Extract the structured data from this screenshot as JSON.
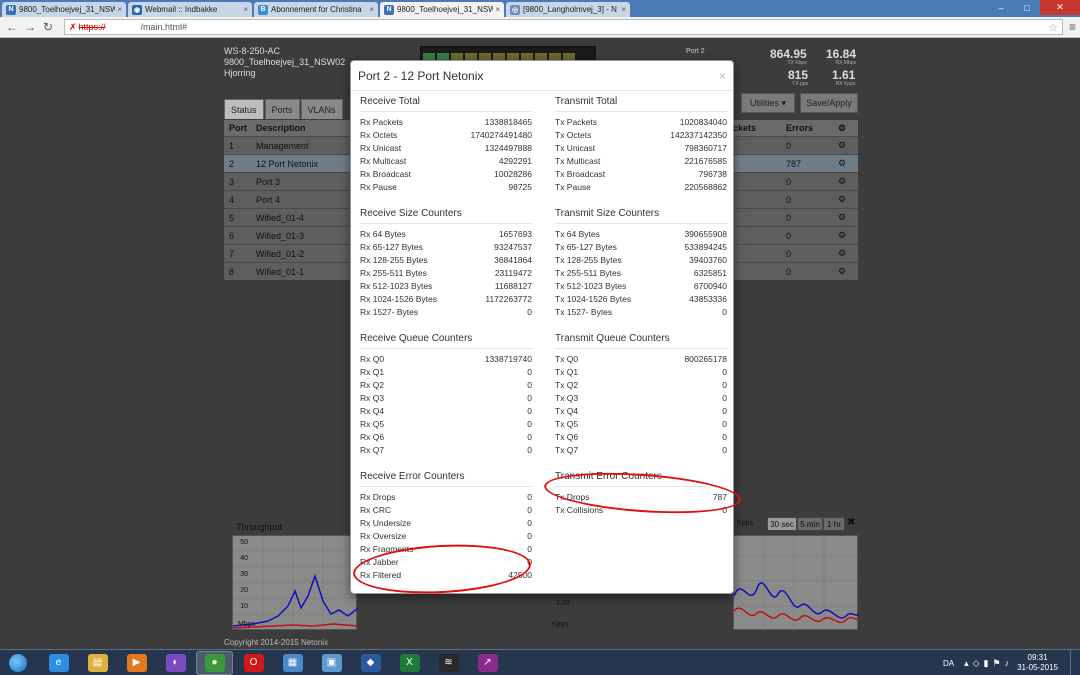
{
  "browser": {
    "tabs": [
      {
        "label": "9800_Toelhoejvej_31_NSW",
        "icon": "N",
        "icon_color": "#3b6fb6",
        "active": false
      },
      {
        "label": "Webmail :: Indbakke",
        "icon": "◉",
        "icon_color": "#2a6aa8",
        "active": false
      },
      {
        "label": "Abonnement for Christina",
        "icon": "B",
        "icon_color": "#3b8fd6",
        "active": false
      },
      {
        "label": "9800_Toelhoejvej_31_NSW",
        "icon": "N",
        "icon_color": "#3b6fb6",
        "active": true
      },
      {
        "label": "[9800_Langholmvej_3] - N",
        "icon": "◎",
        "icon_color": "#6a8fbf",
        "active": false
      }
    ],
    "url_scheme": "https://",
    "url_path": "/main.html#"
  },
  "device": {
    "model": "WS-8-250-AC",
    "name": "9800_Toelhoejvej_31_NSW02",
    "location": "Hjorring",
    "port_label": "Port 2",
    "stats": [
      {
        "value": "864.95",
        "unit": "TX Kbps"
      },
      {
        "value": "16.84",
        "unit": "RX Mbps"
      },
      {
        "value": "815",
        "unit": "TX pps"
      },
      {
        "value": "1.61",
        "unit": "RX Kpps"
      }
    ]
  },
  "page_tabs": [
    "Status",
    "Ports",
    "VLANs"
  ],
  "buttons": {
    "utilities": "Utilities ▾",
    "save": "Save/Apply"
  },
  "ports_table": {
    "headers": {
      "port": "Port",
      "description": "Description",
      "packets": "ackets",
      "errors": "Errors"
    },
    "rows": [
      {
        "port": "1",
        "desc": "Management",
        "errors": "0"
      },
      {
        "port": "2",
        "desc": "12 Port Netonix",
        "errors": "787"
      },
      {
        "port": "3",
        "desc": "Port 3",
        "errors": "0"
      },
      {
        "port": "4",
        "desc": "Port 4",
        "errors": "0"
      },
      {
        "port": "5",
        "desc": "Wified_01-4",
        "errors": "0"
      },
      {
        "port": "6",
        "desc": "Wified_01-3",
        "errors": "0"
      },
      {
        "port": "7",
        "desc": "Wified_01-2",
        "errors": "0"
      },
      {
        "port": "8",
        "desc": "Wified_01-1",
        "errors": "0"
      }
    ]
  },
  "throughput": {
    "title": "Throughput",
    "yticks": [
      "50",
      "40",
      "30",
      "20",
      "10"
    ],
    "unit_left": "Mbps",
    "unit_right": "Kpps",
    "right_tick": "1.00",
    "ranges": [
      "30 sec",
      "5 min",
      "1 hr"
    ],
    "close": "✖"
  },
  "copyright": "Copyright 2014-2015 Netonix",
  "modal": {
    "title": "Port 2 - 12 Port Netonix",
    "close": "×",
    "left": [
      {
        "title": "Receive Total",
        "rows": [
          {
            "k": "Rx Packets",
            "v": "1338818465"
          },
          {
            "k": "Rx Octets",
            "v": "1740274491480"
          },
          {
            "k": "Rx Unicast",
            "v": "1324497888"
          },
          {
            "k": "Rx Multicast",
            "v": "4292291"
          },
          {
            "k": "Rx Broadcast",
            "v": "10028286"
          },
          {
            "k": "Rx Pause",
            "v": "98725"
          }
        ]
      },
      {
        "title": "Receive Size Counters",
        "rows": [
          {
            "k": "Rx 64 Bytes",
            "v": "1657693"
          },
          {
            "k": "Rx 65-127 Bytes",
            "v": "93247537"
          },
          {
            "k": "Rx 128-255 Bytes",
            "v": "36841864"
          },
          {
            "k": "Rx 255-511 Bytes",
            "v": "23119472"
          },
          {
            "k": "Rx 512-1023 Bytes",
            "v": "11688127"
          },
          {
            "k": "Rx 1024-1526 Bytes",
            "v": "1172263772"
          },
          {
            "k": "Rx 1527- Bytes",
            "v": "0"
          }
        ]
      },
      {
        "title": "Receive Queue Counters",
        "rows": [
          {
            "k": "Rx Q0",
            "v": "1338719740"
          },
          {
            "k": "Rx Q1",
            "v": "0"
          },
          {
            "k": "Rx Q2",
            "v": "0"
          },
          {
            "k": "Rx Q3",
            "v": "0"
          },
          {
            "k": "Rx Q4",
            "v": "0"
          },
          {
            "k": "Rx Q5",
            "v": "0"
          },
          {
            "k": "Rx Q6",
            "v": "0"
          },
          {
            "k": "Rx Q7",
            "v": "0"
          }
        ]
      },
      {
        "title": "Receive Error Counters",
        "rows": [
          {
            "k": "Rx Drops",
            "v": "0"
          },
          {
            "k": "Rx CRC",
            "v": "0"
          },
          {
            "k": "Rx Undersize",
            "v": "0"
          },
          {
            "k": "Rx Oversize",
            "v": "0"
          },
          {
            "k": "Rx Fragments",
            "v": "0"
          },
          {
            "k": "Rx Jabber",
            "v": "0"
          },
          {
            "k": "Rx Filtered",
            "v": "42500"
          }
        ]
      }
    ],
    "right": [
      {
        "title": "Transmit Total",
        "rows": [
          {
            "k": "Tx Packets",
            "v": "1020834040"
          },
          {
            "k": "Tx Octets",
            "v": "142337142350"
          },
          {
            "k": "Tx Unicast",
            "v": "798360717"
          },
          {
            "k": "Tx Multicast",
            "v": "221676585"
          },
          {
            "k": "Tx Broadcast",
            "v": "796738"
          },
          {
            "k": "Tx Pause",
            "v": "220568862"
          }
        ]
      },
      {
        "title": "Transmit Size Counters",
        "rows": [
          {
            "k": "Tx 64 Bytes",
            "v": "390655908"
          },
          {
            "k": "Tx 65-127 Bytes",
            "v": "533894245"
          },
          {
            "k": "Tx 128-255 Bytes",
            "v": "39403760"
          },
          {
            "k": "Tx 255-511 Bytes",
            "v": "6325851"
          },
          {
            "k": "Tx 512-1023 Bytes",
            "v": "6700940"
          },
          {
            "k": "Tx 1024-1526 Bytes",
            "v": "43853336"
          },
          {
            "k": "Tx 1527- Bytes",
            "v": "0"
          }
        ]
      },
      {
        "title": "Transmit Queue Counters",
        "rows": [
          {
            "k": "Tx Q0",
            "v": "800265178"
          },
          {
            "k": "Tx Q1",
            "v": "0"
          },
          {
            "k": "Tx Q2",
            "v": "0"
          },
          {
            "k": "Tx Q3",
            "v": "0"
          },
          {
            "k": "Tx Q4",
            "v": "0"
          },
          {
            "k": "Tx Q5",
            "v": "0"
          },
          {
            "k": "Tx Q6",
            "v": "0"
          },
          {
            "k": "Tx Q7",
            "v": "0"
          }
        ]
      },
      {
        "title": "Transmit Error Counters",
        "rows": [
          {
            "k": "Tx Drops",
            "v": "787"
          },
          {
            "k": "Tx Collisions",
            "v": "0"
          }
        ]
      }
    ]
  },
  "taskbar": {
    "apps": [
      {
        "name": "ie-icon",
        "glyph": "e",
        "color": "#2d8ee0"
      },
      {
        "name": "explorer-icon",
        "glyph": "▤",
        "color": "#e0b040"
      },
      {
        "name": "media-player-icon",
        "glyph": "▶",
        "color": "#e07a20"
      },
      {
        "name": "bittorrent-icon",
        "glyph": "◐",
        "color": "#7a4ac0"
      },
      {
        "name": "chrome-icon",
        "glyph": "●",
        "color": "#3a9a3a"
      },
      {
        "name": "opera-icon",
        "glyph": "O",
        "color": "#d01818"
      },
      {
        "name": "control-panel-icon",
        "glyph": "▦",
        "color": "#4a8ac8"
      },
      {
        "name": "remote-desktop-icon",
        "glyph": "▣",
        "color": "#5a9ad0"
      },
      {
        "name": "virtualbox-icon",
        "glyph": "◆",
        "color": "#2a5a9a"
      },
      {
        "name": "excel-icon",
        "glyph": "X",
        "color": "#1e7a3a"
      },
      {
        "name": "winbox-icon",
        "glyph": "≋",
        "color": "#2a2a2a"
      },
      {
        "name": "stats-icon",
        "glyph": "↗",
        "color": "#8a2a8a"
      }
    ],
    "lang": "DA",
    "time": "09:31",
    "date": "31-05-2015"
  }
}
